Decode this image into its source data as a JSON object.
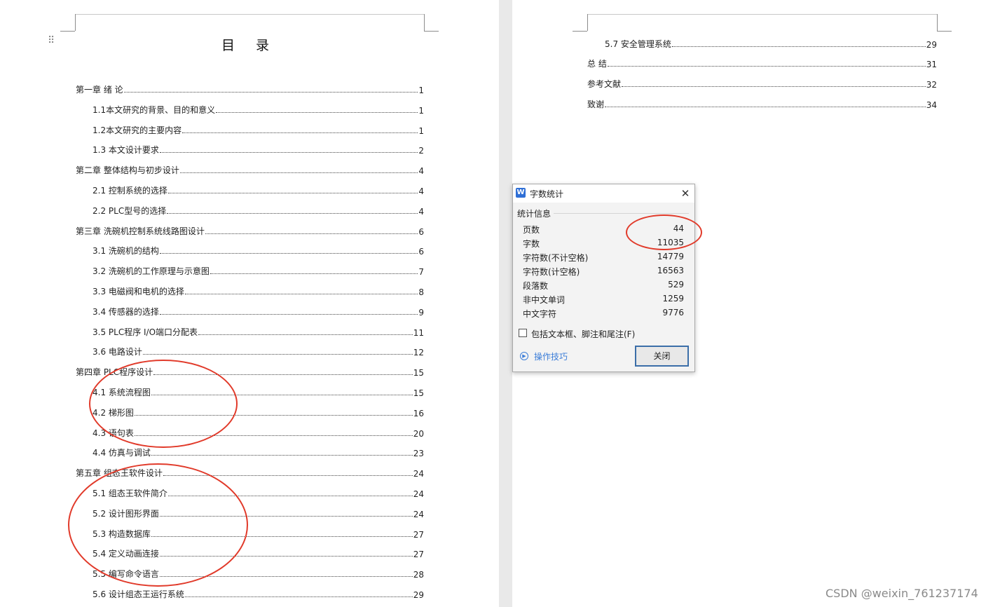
{
  "toc": {
    "title": "目 录",
    "left_page": [
      {
        "text": "第一章  绪  论",
        "page": "1"
      },
      {
        "text": "1.1本文研究的背景、目的和意义",
        "page": "1"
      },
      {
        "text": "1.2本文研究的主要内容",
        "page": "1"
      },
      {
        "text": "1.3  本文设计要求",
        "page": "2"
      },
      {
        "text": "第二章  整体结构与初步设计",
        "page": "4"
      },
      {
        "text": "2.1  控制系统的选择",
        "page": "4"
      },
      {
        "text": "2.2    PLC型号的选择",
        "page": "4"
      },
      {
        "text": "第三章  洗碗机控制系统线路图设计",
        "page": "6"
      },
      {
        "text": "3.1  洗碗机的结构",
        "page": "6"
      },
      {
        "text": "3.2  洗碗机的工作原理与示意图",
        "page": "7"
      },
      {
        "text": "3.3  电磁阀和电机的选择",
        "page": "8"
      },
      {
        "text": "3.4  传感器的选择",
        "page": "9"
      },
      {
        "text": "3.5  PLC程序 I/O端口分配表",
        "page": "11"
      },
      {
        "text": "3.6  电路设计",
        "page": "12"
      },
      {
        "text": "第四章  PLC程序设计",
        "page": "15"
      },
      {
        "text": "4.1  系统流程图",
        "page": "15"
      },
      {
        "text": "4.2  梯形图",
        "page": "16"
      },
      {
        "text": "4.3  语句表",
        "page": "20"
      },
      {
        "text": "4.4    仿真与调试",
        "page": "23"
      },
      {
        "text": "第五章  组态王软件设计",
        "page": "24"
      },
      {
        "text": "5.1  组态王软件简介",
        "page": "24"
      },
      {
        "text": "5.2  设计图形界面",
        "page": "24"
      },
      {
        "text": "5.3  构造数据库",
        "page": "27"
      },
      {
        "text": "5.4 定义动画连接",
        "page": "27"
      },
      {
        "text": "5.5 编写命令语言",
        "page": "28"
      },
      {
        "text": "5.6  设计组态王运行系统",
        "page": "29"
      }
    ],
    "right_page": [
      {
        "text": "5.7  安全管理系统",
        "page": "29"
      },
      {
        "text": "总  结",
        "page": "31"
      },
      {
        "text": "参考文献",
        "page": "32"
      },
      {
        "text": "致谢",
        "page": "34"
      }
    ]
  },
  "dialog": {
    "app_icon": "W",
    "title": "字数统计",
    "close_glyph": "✕",
    "group_label": "统计信息",
    "stats": [
      {
        "label": "页数",
        "value": "44"
      },
      {
        "label": "字数",
        "value": "11035"
      },
      {
        "label": "字符数(不计空格)",
        "value": "14779"
      },
      {
        "label": "字符数(计空格)",
        "value": "16563"
      },
      {
        "label": "段落数",
        "value": "529"
      },
      {
        "label": "非中文单词",
        "value": "1259"
      },
      {
        "label": "中文字符",
        "value": "9776"
      }
    ],
    "checkbox_label": "包括文本框、脚注和尾注(F)",
    "checkbox_checked": false,
    "tips_link": "操作技巧",
    "close_button": "关闭"
  },
  "watermark": "CSDN @weixin_761237174",
  "colors": {
    "annotation_red": "#e13a2a",
    "link_blue": "#3b7dd8",
    "button_border": "#3b6ea8"
  },
  "icons": [
    "drag-handle-icon",
    "wps-writer-icon",
    "close-icon",
    "tips-play-icon",
    "checkbox-icon"
  ]
}
